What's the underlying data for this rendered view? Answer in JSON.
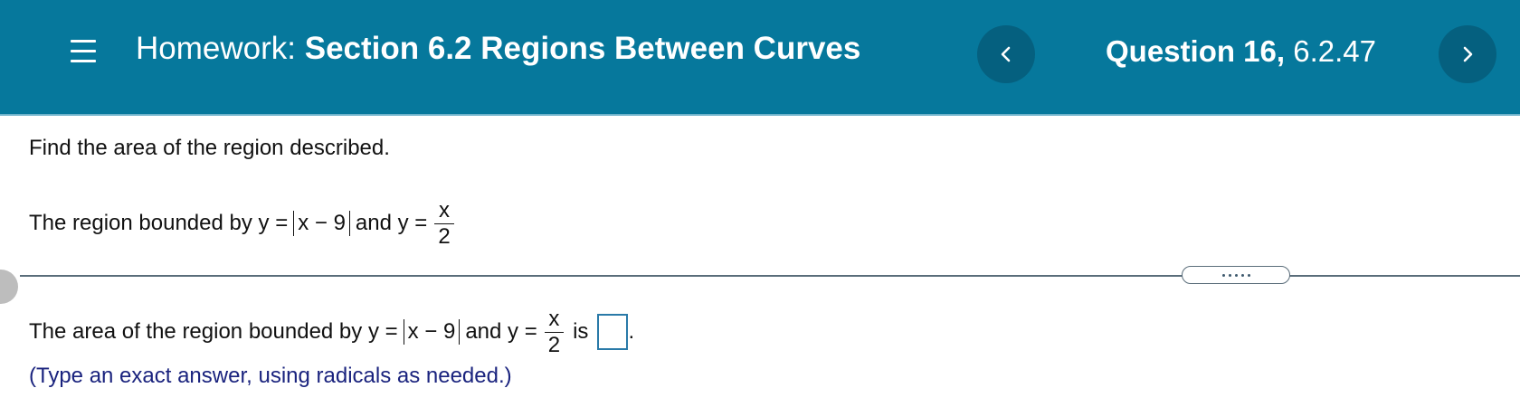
{
  "header": {
    "title_prefix": "Homework:",
    "title_bold": "Section 6.2 Regions Between Curves",
    "question_bold": "Question 16,",
    "question_id": "6.2.47"
  },
  "colors": {
    "header_bg": "#06789c",
    "nav_button_bg": "#05607f",
    "hint_text": "#1a237e",
    "answer_box_border": "#2a7aa8"
  },
  "icons": {
    "menu": "hamburger-icon",
    "prev": "chevron-left-icon",
    "next": "chevron-right-icon",
    "splitter": "drag-handle-dots"
  },
  "content": {
    "instruction": "Find the area of the region described.",
    "problem": {
      "text1": "The region bounded by y =",
      "abs_expr": "x − 9",
      "text2": "and y =",
      "frac_num": "x",
      "frac_den": "2"
    },
    "answer": {
      "text1": "The area of the region bounded by y =",
      "abs_expr": "x − 9",
      "text2": "and y =",
      "frac_num": "x",
      "frac_den": "2",
      "text3": "is",
      "period": ".",
      "value": ""
    },
    "hint": "(Type an exact answer, using radicals as needed.)"
  }
}
